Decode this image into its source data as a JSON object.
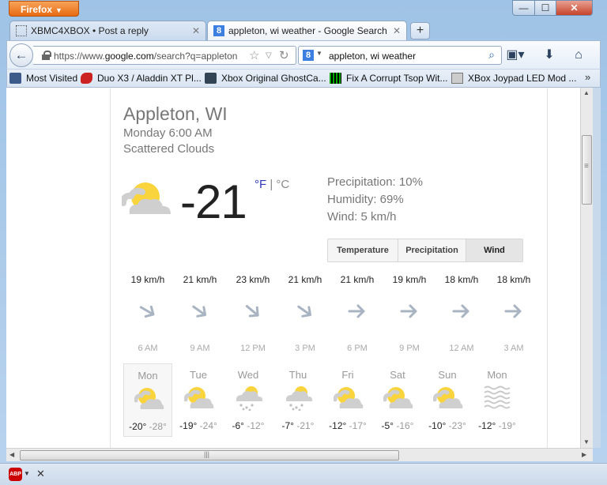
{
  "browser": {
    "app_button": "Firefox",
    "window_controls": {
      "minimize": "—",
      "maximize": "☐",
      "close": "✕"
    }
  },
  "tabs": [
    {
      "title": "XBMC4XBOX • Post a reply",
      "active": false
    },
    {
      "title": "appleton, wi weather - Google Search",
      "active": true
    }
  ],
  "new_tab_label": "+",
  "navbar": {
    "url_prefix": "https://www.",
    "url_host": "google.com",
    "url_rest": "/search?q=appleton",
    "search_engine_icon": "8",
    "search_value": "appleton, wi weather"
  },
  "bookmarks": [
    {
      "label": "Most Visited",
      "icon": "mv"
    },
    {
      "label": "Duo X3 / Aladdin XT Pl...",
      "icon": "rd"
    },
    {
      "label": "Xbox Original GhostCa...",
      "icon": "xg"
    },
    {
      "label": "Fix A Corrupt Tsop Wit...",
      "icon": "gr"
    },
    {
      "label": "XBox Joypad LED Mod ...",
      "icon": "jp"
    }
  ],
  "bookmarks_overflow": "»",
  "weather": {
    "location": "Appleton, WI",
    "datetime": "Monday 6:00 AM",
    "condition": "Scattered Clouds",
    "temperature": "-21",
    "unit_f": "°F",
    "unit_sep": " | ",
    "unit_c": "°C",
    "precipitation": "Precipitation: 10%",
    "humidity": "Humidity: 69%",
    "wind": "Wind: 5 km/h",
    "tabs": [
      "Temperature",
      "Precipitation",
      "Wind"
    ],
    "active_tab": "Wind",
    "hourly": [
      {
        "speed": "19 km/h",
        "time": "6 AM"
      },
      {
        "speed": "21 km/h",
        "time": "9 AM"
      },
      {
        "speed": "23 km/h",
        "time": "12 PM"
      },
      {
        "speed": "21 km/h",
        "time": "3 PM"
      },
      {
        "speed": "21 km/h",
        "time": "6 PM"
      },
      {
        "speed": "19 km/h",
        "time": "9 PM"
      },
      {
        "speed": "18 km/h",
        "time": "12 AM"
      },
      {
        "speed": "18 km/h",
        "time": "3 AM"
      }
    ],
    "daily": [
      {
        "day": "Mon",
        "high": "-20°",
        "low": "-28°",
        "icon": "partly-cloudy"
      },
      {
        "day": "Tue",
        "high": "-19°",
        "low": "-24°",
        "icon": "partly-cloudy"
      },
      {
        "day": "Wed",
        "high": "-6°",
        "low": "-12°",
        "icon": "snow-cloud"
      },
      {
        "day": "Thu",
        "high": "-7°",
        "low": "-21°",
        "icon": "snow-cloud"
      },
      {
        "day": "Fri",
        "high": "-12°",
        "low": "-17°",
        "icon": "partly-cloudy"
      },
      {
        "day": "Sat",
        "high": "-5°",
        "low": "-16°",
        "icon": "partly-cloudy"
      },
      {
        "day": "Sun",
        "high": "-10°",
        "low": "-23°",
        "icon": "partly-cloudy"
      },
      {
        "day": "Mon",
        "high": "-12°",
        "low": "-19°",
        "icon": "haze"
      }
    ]
  },
  "addon_bar": {
    "abp_label": "ABP",
    "close": "✕"
  }
}
